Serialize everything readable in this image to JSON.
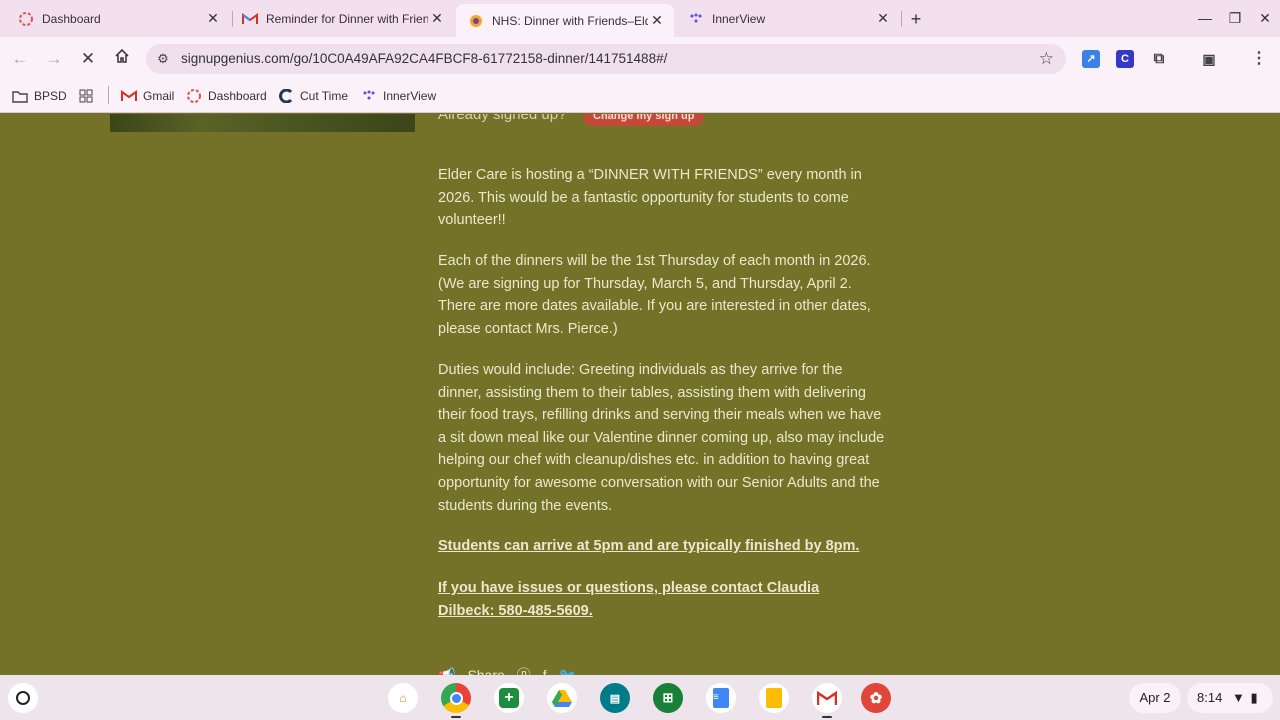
{
  "tabs": [
    {
      "title": "Dashboard",
      "icon": "asana-icon"
    },
    {
      "title": "Reminder for Dinner with Friends",
      "icon": "gmail-icon"
    },
    {
      "title": "NHS: Dinner with Friends–Elder",
      "icon": "signupgenius-icon"
    },
    {
      "title": "InnerView",
      "icon": "innerview-icon"
    }
  ],
  "toolbar": {
    "url": "signupgenius.com/go/10C0A49AFA92CA4FBCF8-61772158-dinner/141751488#/"
  },
  "bookmarks": [
    {
      "label": "BPSD",
      "icon": "folder-icon"
    },
    {
      "label": "Gmail",
      "icon": "gmail-icon"
    },
    {
      "label": "Dashboard",
      "icon": "asana-icon"
    },
    {
      "label": "Cut Time",
      "icon": "cuttime-icon"
    },
    {
      "label": "InnerView",
      "icon": "innerview-icon"
    }
  ],
  "page": {
    "already_signed_up": "Already signed up?",
    "change_button": "Change my sign up",
    "para1": "Elder Care is hosting a “DINNER WITH FRIENDS” every month in 2026. This would be a fantastic opportunity for students to come volunteer!!",
    "para2": "Each of the dinners will be the 1st Thursday of each month in 2026. (We are signing up for Thursday, March 5, and Thursday, April 2. There are more dates available.  If you are interested in other dates, please contact Mrs. Pierce.)",
    "para3": "Duties would include: Greeting individuals as they arrive for the dinner, assisting them to their tables, assisting them with delivering their food trays, refilling drinks and serving their meals when we have a sit down meal like our Valentine dinner coming up, also may include helping our chef with cleanup/dishes etc. in addition to having great opportunity for awesome conversation with our Senior Adults and the students during the events.",
    "para4": "Students can arrive at 5pm and are typically finished by 8pm.",
    "para5": "If you have issues or questions, please contact Claudia Dilbeck: 580-485-5609.",
    "share": "Share"
  },
  "shelf": {
    "date": "Apr 2",
    "time": "8:14"
  },
  "colors": {
    "page_bg": "#747129",
    "text": "#ece8cc",
    "accent_button": "#c44a37",
    "chrome_frame": "#f2e0ef"
  }
}
